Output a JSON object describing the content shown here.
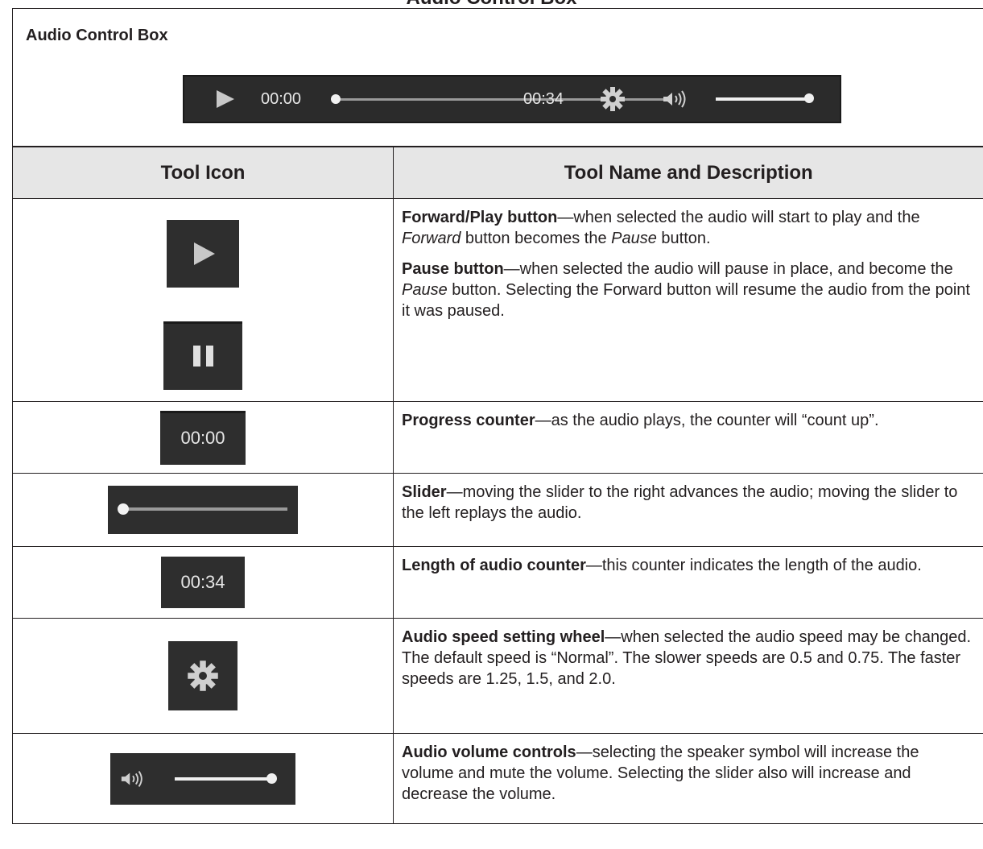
{
  "page": {
    "top_title": "Audio Control Box",
    "box_title": "Audio Control Box"
  },
  "player": {
    "current_time": "00:00",
    "length": "00:34",
    "progress": 0.0,
    "volume": 0.95,
    "colors": {
      "background": "#2b2b2b",
      "foreground": "#e6e6e6"
    }
  },
  "table": {
    "headers": [
      "Tool Icon",
      "Tool Name and Description"
    ],
    "rows": [
      {
        "icons": [
          "play-icon",
          "pause-icon"
        ],
        "paragraphs": [
          {
            "name": "Forward/Play button",
            "pre": "—when selected the audio will start to play and the ",
            "em1": "Forward",
            "mid": " button becomes the ",
            "em2": "Pause",
            "post": " button."
          },
          {
            "name": "Pause button",
            "pre": "—when selected the audio will pause in place, and become the ",
            "em1": "Pause",
            "post": " button. Selecting the Forward button will resume the audio from the point it was paused."
          }
        ]
      },
      {
        "icon_text": "00:00",
        "name": "Progress counter",
        "text": "—as the audio plays, the counter will “count up”."
      },
      {
        "icon": "slider-icon",
        "name": "Slider",
        "text": "—moving the slider to the right advances the audio; moving the slider to the left replays the audio."
      },
      {
        "icon_text": "00:34",
        "name": "Length of audio counter",
        "text": "—this counter indicates the length of the audio."
      },
      {
        "icon": "gear-icon",
        "name": "Audio speed setting wheel",
        "text": "—when selected the audio speed may be changed. The default speed is “Normal”. The slower speeds are 0.5 and 0.75. The faster speeds are 1.25, 1.5, and 2.0."
      },
      {
        "icon": "volume-icon",
        "name": "Audio volume controls",
        "text": "—selecting the speaker symbol will increase the volume and mute the volume. Selecting the slider also will increase and decrease the volume."
      }
    ]
  }
}
